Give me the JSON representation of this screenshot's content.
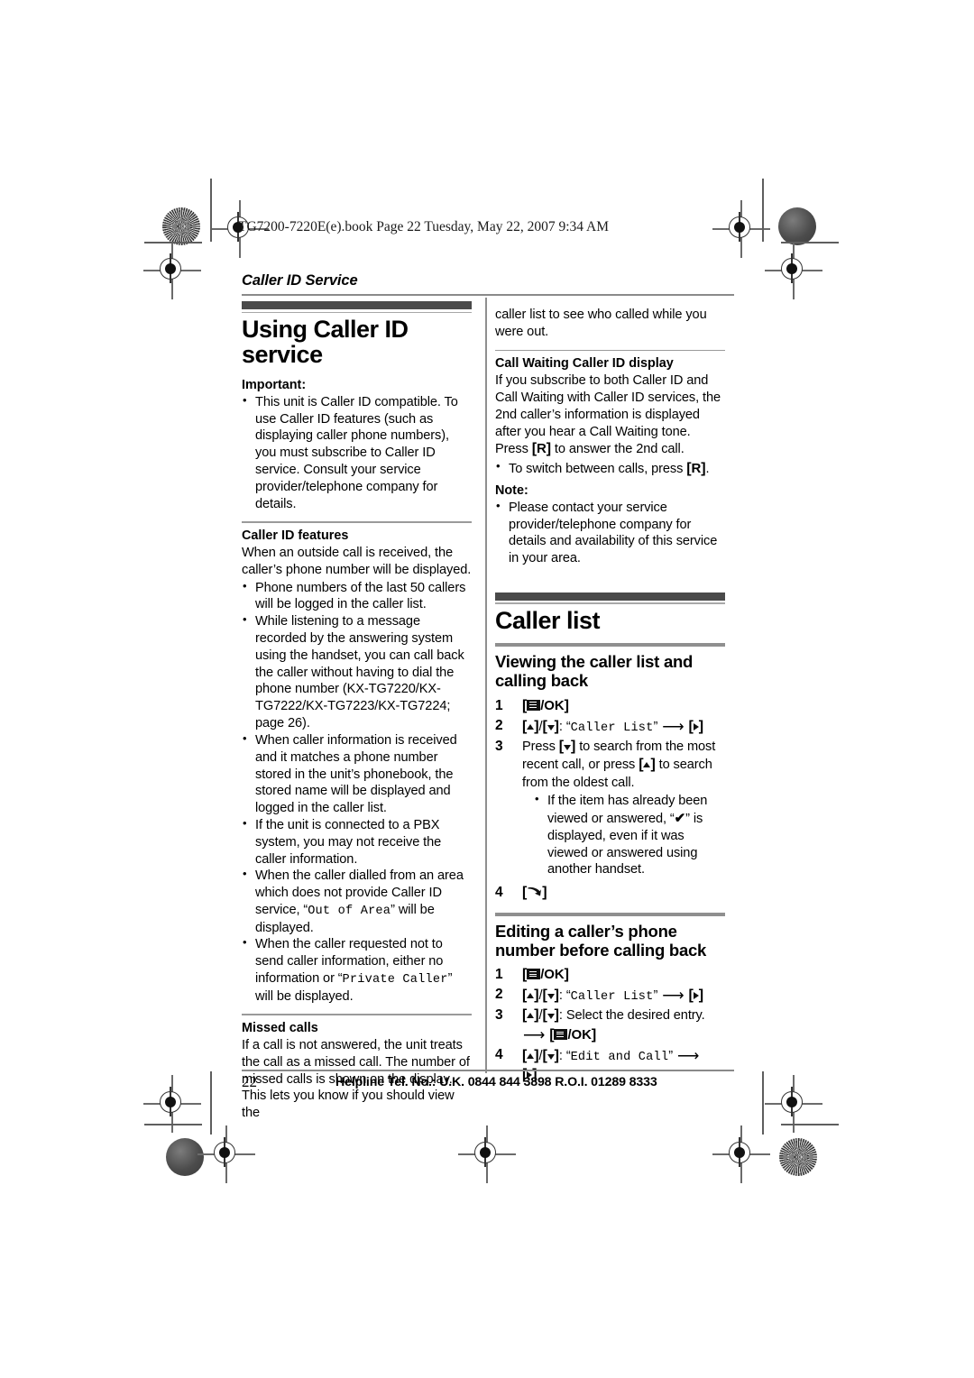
{
  "marks": {
    "book_line": "TG7200-7220E(e).book  Page 22  Tuesday, May 22, 2007  9:34 AM"
  },
  "running_head": "Caller ID Service",
  "left_column": {
    "section_title": "Using Caller ID service",
    "important_label": "Important:",
    "important_bullets": [
      "This unit is Caller ID compatible. To use Caller ID features (such as displaying caller phone numbers), you must subscribe to Caller ID service. Consult your service provider/telephone company for details."
    ],
    "caller_id_features": {
      "heading": "Caller ID features",
      "intro": "When an outside call is received, the caller’s phone number will be displayed.",
      "bullets": [
        "Phone numbers of the last 50 callers will be logged in the caller list.",
        "While listening to a message recorded by the answering system using the handset, you can call back the caller without having to dial the phone number (KX-TG7220/KX-TG7222/KX-TG7223/KX-TG7224; page 26).",
        "When caller information is received and it matches a phone number stored in the unit’s phonebook, the stored name will be displayed and logged in the caller list.",
        "If the unit is connected to a PBX system, you may not receive the caller information."
      ],
      "bullet_out_of_area": {
        "before": "When the caller dialled from an area which does not provide Caller ID service, “",
        "display": "Out of Area",
        "after": "” will be displayed."
      },
      "bullet_private_caller": {
        "before": "When the caller requested not to send caller information, either no information or “",
        "display": "Private Caller",
        "after": "” will be displayed."
      }
    },
    "missed_calls": {
      "heading": "Missed calls",
      "text": "If a call is not answered, the unit treats the call as a missed call. The number of missed calls is shown on the display. This lets you know if you should view the"
    }
  },
  "right_column": {
    "continuation": "caller list to see who called while you were out.",
    "call_waiting": {
      "heading": "Call Waiting Caller ID display",
      "para_before_key": "If you subscribe to both Caller ID and Call Waiting with Caller ID services, the 2nd caller’s information is displayed after you hear a Call Waiting tone. Press ",
      "key_r": "R",
      "para_after_key": " to answer the 2nd call.",
      "bullet_before_key": "To switch between calls, press ",
      "bullet_after_key": "."
    },
    "note": {
      "label": "Note:",
      "bullets": [
        "Please contact your service provider/telephone company for details and availability of this service in your area."
      ]
    },
    "caller_list": {
      "section_title": "Caller list",
      "viewing": {
        "heading": "Viewing the caller list and calling back",
        "steps": [
          {
            "num": "1",
            "type": "key_ok"
          },
          {
            "num": "2",
            "type": "updown_select",
            "display": "Caller List"
          },
          {
            "num": "3",
            "type": "text_keys",
            "t1": "Press ",
            "t2": " to search from the most recent call, or press ",
            "t3": " to search from the oldest call.",
            "sub_bullets": [
              {
                "before": "If the item has already been viewed or answered, “",
                "tick": "✔",
                "after": "” is displayed, even if it was viewed or answered using another handset."
              }
            ]
          },
          {
            "num": "4",
            "type": "key_talk"
          }
        ]
      },
      "editing": {
        "heading": "Editing a caller’s phone number before calling back",
        "steps": [
          {
            "num": "1",
            "type": "key_ok"
          },
          {
            "num": "2",
            "type": "updown_select",
            "display": "Caller List"
          },
          {
            "num": "3",
            "type": "updown_entry",
            "text": ": Select the desired entry."
          },
          {
            "num": "4",
            "type": "updown_select_wrap",
            "display": "Edit and Call"
          }
        ]
      }
    }
  },
  "footer": {
    "page_number": "22",
    "helpline": "Helpline Tel. No.: U.K. 0844 844 3898 R.O.I. 01289 8333"
  }
}
